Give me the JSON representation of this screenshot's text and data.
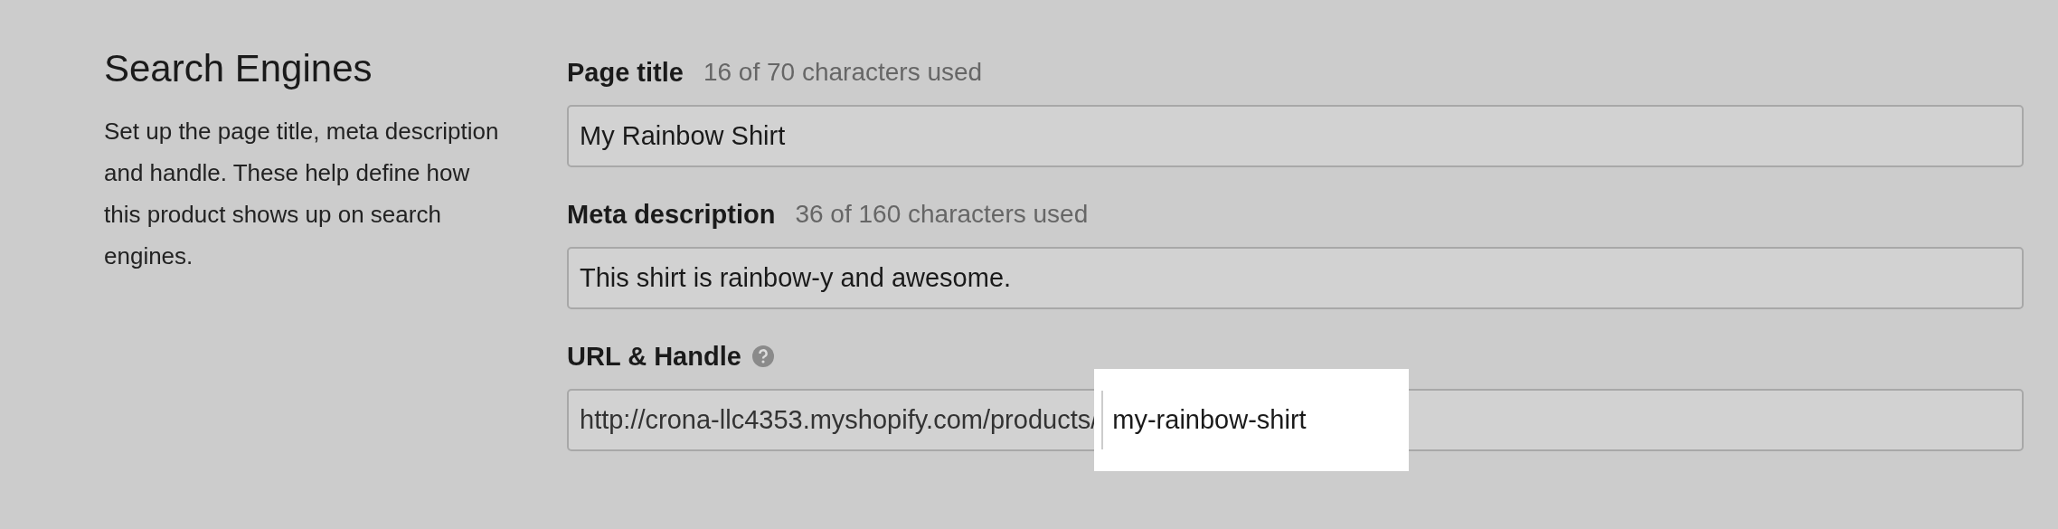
{
  "section": {
    "title": "Search Engines",
    "description": "Set up the page title, meta description and handle. These help define how this product shows up on search engines."
  },
  "fields": [
    {
      "label": "Page title",
      "counter": "16 of 70 characters used",
      "value": "My Rainbow Shirt"
    },
    {
      "label": "Meta description",
      "counter": "36 of 160 characters used",
      "value": "This shirt is rainbow-y and awesome."
    }
  ],
  "url_field": {
    "label": "URL & Handle",
    "prefix": "http://crona-llc4353.myshopify.com/products/",
    "value": "my-rainbow-shirt",
    "highlighted": true
  }
}
